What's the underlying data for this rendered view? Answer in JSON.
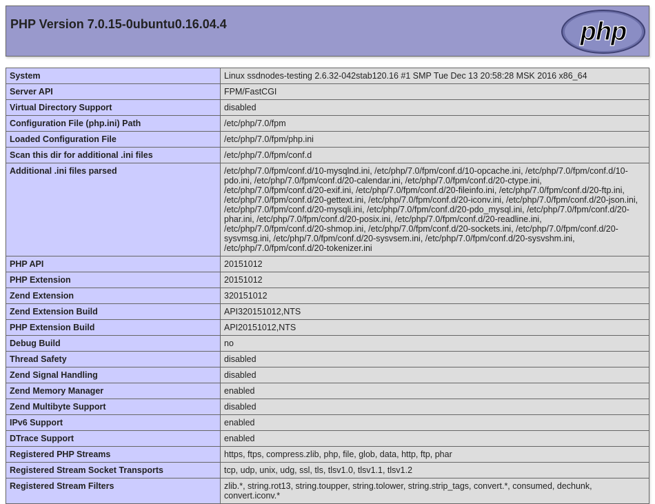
{
  "header": {
    "title": "PHP Version 7.0.15-0ubuntu0.16.04.4",
    "logo_text": "php"
  },
  "colors": {
    "header_bg": "#9999cc",
    "key_bg": "#ccccff",
    "value_bg": "#dddddd",
    "border": "#666666"
  },
  "rows": [
    {
      "key": "System",
      "value": "Linux ssdnodes-testing 2.6.32-042stab120.16 #1 SMP Tue Dec 13 20:58:28 MSK 2016 x86_64"
    },
    {
      "key": "Server API",
      "value": "FPM/FastCGI"
    },
    {
      "key": "Virtual Directory Support",
      "value": "disabled"
    },
    {
      "key": "Configuration File (php.ini) Path",
      "value": "/etc/php/7.0/fpm"
    },
    {
      "key": "Loaded Configuration File",
      "value": "/etc/php/7.0/fpm/php.ini"
    },
    {
      "key": "Scan this dir for additional .ini files",
      "value": "/etc/php/7.0/fpm/conf.d"
    },
    {
      "key": "Additional .ini files parsed",
      "value": "/etc/php/7.0/fpm/conf.d/10-mysqlnd.ini, /etc/php/7.0/fpm/conf.d/10-opcache.ini, /etc/php/7.0/fpm/conf.d/10-pdo.ini, /etc/php/7.0/fpm/conf.d/20-calendar.ini, /etc/php/7.0/fpm/conf.d/20-ctype.ini, /etc/php/7.0/fpm/conf.d/20-exif.ini, /etc/php/7.0/fpm/conf.d/20-fileinfo.ini, /etc/php/7.0/fpm/conf.d/20-ftp.ini, /etc/php/7.0/fpm/conf.d/20-gettext.ini, /etc/php/7.0/fpm/conf.d/20-iconv.ini, /etc/php/7.0/fpm/conf.d/20-json.ini, /etc/php/7.0/fpm/conf.d/20-mysqli.ini, /etc/php/7.0/fpm/conf.d/20-pdo_mysql.ini, /etc/php/7.0/fpm/conf.d/20-phar.ini, /etc/php/7.0/fpm/conf.d/20-posix.ini, /etc/php/7.0/fpm/conf.d/20-readline.ini, /etc/php/7.0/fpm/conf.d/20-shmop.ini, /etc/php/7.0/fpm/conf.d/20-sockets.ini, /etc/php/7.0/fpm/conf.d/20-sysvmsg.ini, /etc/php/7.0/fpm/conf.d/20-sysvsem.ini, /etc/php/7.0/fpm/conf.d/20-sysvshm.ini, /etc/php/7.0/fpm/conf.d/20-tokenizer.ini"
    },
    {
      "key": "PHP API",
      "value": "20151012"
    },
    {
      "key": "PHP Extension",
      "value": "20151012"
    },
    {
      "key": "Zend Extension",
      "value": "320151012"
    },
    {
      "key": "Zend Extension Build",
      "value": "API320151012,NTS"
    },
    {
      "key": "PHP Extension Build",
      "value": "API20151012,NTS"
    },
    {
      "key": "Debug Build",
      "value": "no"
    },
    {
      "key": "Thread Safety",
      "value": "disabled"
    },
    {
      "key": "Zend Signal Handling",
      "value": "disabled"
    },
    {
      "key": "Zend Memory Manager",
      "value": "enabled"
    },
    {
      "key": "Zend Multibyte Support",
      "value": "disabled"
    },
    {
      "key": "IPv6 Support",
      "value": "enabled"
    },
    {
      "key": "DTrace Support",
      "value": "enabled"
    },
    {
      "key": "Registered PHP Streams",
      "value": "https, ftps, compress.zlib, php, file, glob, data, http, ftp, phar"
    },
    {
      "key": "Registered Stream Socket Transports",
      "value": "tcp, udp, unix, udg, ssl, tls, tlsv1.0, tlsv1.1, tlsv1.2"
    },
    {
      "key": "Registered Stream Filters",
      "value": "zlib.*, string.rot13, string.toupper, string.tolower, string.strip_tags, convert.*, consumed, dechunk, convert.iconv.*"
    }
  ]
}
